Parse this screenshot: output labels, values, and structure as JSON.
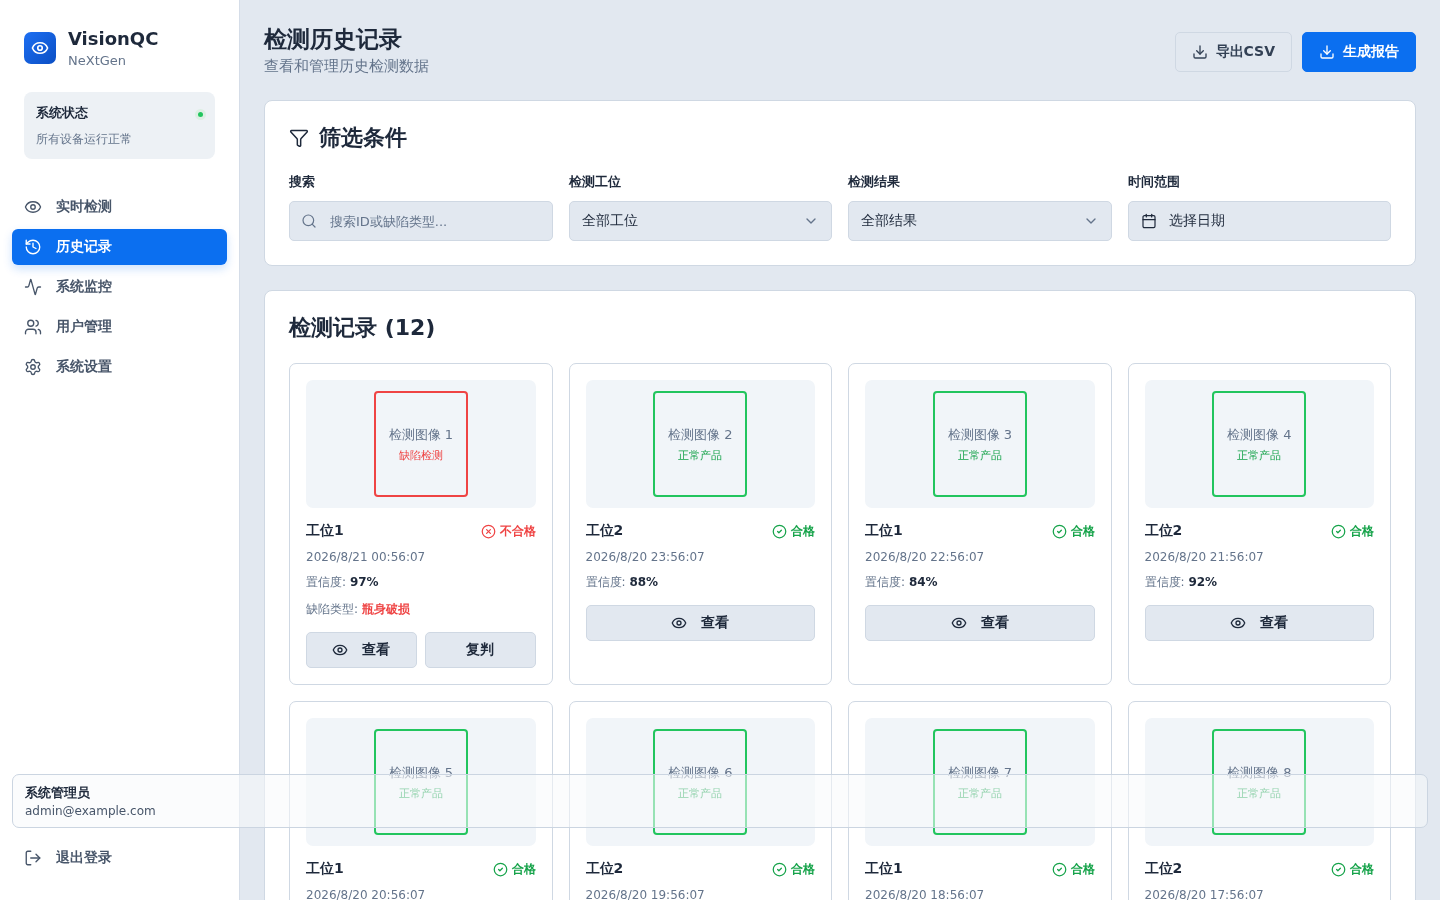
{
  "brand": {
    "name": "VisionQC",
    "subtitle": "NeXtGen"
  },
  "system_status": {
    "title": "系统状态",
    "message": "所有设备运行正常",
    "color": "#22c55e"
  },
  "nav": [
    {
      "kind": "eye",
      "label": "实时检测",
      "selected": false
    },
    {
      "kind": "history",
      "label": "历史记录",
      "selected": true
    },
    {
      "kind": "activity",
      "label": "系统监控",
      "selected": false
    },
    {
      "kind": "users",
      "label": "用户管理",
      "selected": false
    },
    {
      "kind": "settings",
      "label": "系统设置",
      "selected": false
    }
  ],
  "user": {
    "name": "系统管理员",
    "email": "admin@example.com"
  },
  "logout": "退出登录",
  "header": {
    "title": "检测历史记录",
    "subtitle": "查看和管理历史检测数据",
    "buttons": [
      {
        "kind": "secondary",
        "label": "导出CSV"
      },
      {
        "kind": "primary",
        "label": "生成报告"
      }
    ]
  },
  "filters": {
    "title": "筛选条件",
    "fields": [
      {
        "kind": "search",
        "label": "搜索",
        "placeholder": "搜索ID或缺陷类型..."
      },
      {
        "kind": "select",
        "label": "检测工位",
        "value": "全部工位"
      },
      {
        "kind": "select",
        "label": "检测结果",
        "value": "全部结果"
      },
      {
        "kind": "date",
        "label": "时间范围",
        "value": "选择日期"
      }
    ]
  },
  "records": {
    "title": "检测记录 (12)",
    "items": [
      {
        "image_label": "检测图像 1",
        "image_tag": "缺陷检测",
        "pass": false,
        "station": "工位1",
        "result": "不合格",
        "time": "2026/8/21 00:56:07",
        "confidence_label": "置信度:",
        "confidence": "97%",
        "defect_label": "缺陷类型:",
        "defect": "瓶身破损",
        "actions": [
          "查看",
          "复判"
        ]
      },
      {
        "image_label": "检测图像 2",
        "image_tag": "正常产品",
        "pass": true,
        "station": "工位2",
        "result": "合格",
        "time": "2026/8/20 23:56:07",
        "confidence_label": "置信度:",
        "confidence": "88%",
        "actions": [
          "查看"
        ]
      },
      {
        "image_label": "检测图像 3",
        "image_tag": "正常产品",
        "pass": true,
        "station": "工位1",
        "result": "合格",
        "time": "2026/8/20 22:56:07",
        "confidence_label": "置信度:",
        "confidence": "84%",
        "actions": [
          "查看"
        ]
      },
      {
        "image_label": "检测图像 4",
        "image_tag": "正常产品",
        "pass": true,
        "station": "工位2",
        "result": "合格",
        "time": "2026/8/20 21:56:07",
        "confidence_label": "置信度:",
        "confidence": "92%",
        "actions": [
          "查看"
        ]
      },
      {
        "image_label": "检测图像 5",
        "image_tag": "正常产品",
        "pass": true,
        "station": "工位1",
        "result": "合格",
        "time": "2026/8/20 20:56:07"
      },
      {
        "image_label": "检测图像 6",
        "image_tag": "正常产品",
        "pass": true,
        "station": "工位2",
        "result": "合格",
        "time": "2026/8/20 19:56:07"
      },
      {
        "image_label": "检测图像 7",
        "image_tag": "正常产品",
        "pass": true,
        "station": "工位1",
        "result": "合格",
        "time": "2026/8/20 18:56:07"
      },
      {
        "image_label": "检测图像 8",
        "image_tag": "正常产品",
        "pass": true,
        "station": "工位2",
        "result": "合格",
        "time": "2026/8/20 17:56:07"
      }
    ]
  }
}
